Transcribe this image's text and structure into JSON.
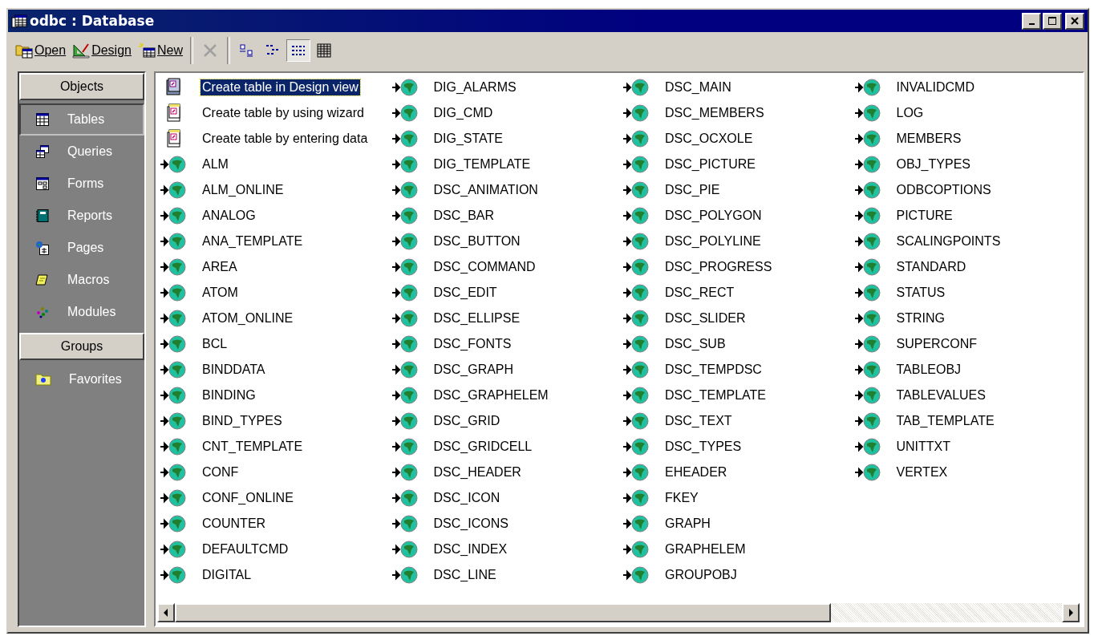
{
  "window": {
    "title": "odbc : Database"
  },
  "toolbar": {
    "buttons": [
      {
        "label": "Open",
        "kind": "open"
      },
      {
        "label": "Design",
        "kind": "design"
      },
      {
        "label": "New",
        "kind": "new"
      }
    ],
    "delete_disabled": true,
    "views": [
      {
        "kind": "large",
        "selected": false
      },
      {
        "kind": "small",
        "selected": false
      },
      {
        "kind": "list",
        "selected": true
      },
      {
        "kind": "details",
        "selected": false
      }
    ]
  },
  "sidebar": {
    "objects_header": "Objects",
    "items": [
      {
        "label": "Tables",
        "kind": "tables",
        "selected": true
      },
      {
        "label": "Queries",
        "kind": "queries",
        "selected": false
      },
      {
        "label": "Forms",
        "kind": "forms",
        "selected": false
      },
      {
        "label": "Reports",
        "kind": "reports",
        "selected": false
      },
      {
        "label": "Pages",
        "kind": "pages",
        "selected": false
      },
      {
        "label": "Macros",
        "kind": "macros",
        "selected": false
      },
      {
        "label": "Modules",
        "kind": "modules",
        "selected": false
      }
    ],
    "groups_header": "Groups",
    "groups": [
      {
        "label": "Favorites",
        "kind": "favorites",
        "selected": false
      }
    ]
  },
  "list": {
    "items": [
      {
        "label": "Create table in Design view",
        "kind": "design",
        "selected": true
      },
      {
        "label": "Create table by using wizard",
        "kind": "wizard",
        "selected": false
      },
      {
        "label": "Create table by entering data",
        "kind": "wizard",
        "selected": false
      },
      {
        "label": "ALM",
        "kind": "table",
        "selected": false
      },
      {
        "label": "ALM_ONLINE",
        "kind": "table",
        "selected": false
      },
      {
        "label": "ANALOG",
        "kind": "table",
        "selected": false
      },
      {
        "label": "ANA_TEMPLATE",
        "kind": "table",
        "selected": false
      },
      {
        "label": "AREA",
        "kind": "table",
        "selected": false
      },
      {
        "label": "ATOM",
        "kind": "table",
        "selected": false
      },
      {
        "label": "ATOM_ONLINE",
        "kind": "table",
        "selected": false
      },
      {
        "label": "BCL",
        "kind": "table",
        "selected": false
      },
      {
        "label": "BINDDATA",
        "kind": "table",
        "selected": false
      },
      {
        "label": "BINDING",
        "kind": "table",
        "selected": false
      },
      {
        "label": "BIND_TYPES",
        "kind": "table",
        "selected": false
      },
      {
        "label": "CNT_TEMPLATE",
        "kind": "table",
        "selected": false
      },
      {
        "label": "CONF",
        "kind": "table",
        "selected": false
      },
      {
        "label": "CONF_ONLINE",
        "kind": "table",
        "selected": false
      },
      {
        "label": "COUNTER",
        "kind": "table",
        "selected": false
      },
      {
        "label": "DEFAULTCMD",
        "kind": "table",
        "selected": false
      },
      {
        "label": "DIGITAL",
        "kind": "table",
        "selected": false
      },
      {
        "label": "DIG_ALARMS",
        "kind": "table",
        "selected": false
      },
      {
        "label": "DIG_CMD",
        "kind": "table",
        "selected": false
      },
      {
        "label": "DIG_STATE",
        "kind": "table",
        "selected": false
      },
      {
        "label": "DIG_TEMPLATE",
        "kind": "table",
        "selected": false
      },
      {
        "label": "DSC_ANIMATION",
        "kind": "table",
        "selected": false
      },
      {
        "label": "DSC_BAR",
        "kind": "table",
        "selected": false
      },
      {
        "label": "DSC_BUTTON",
        "kind": "table",
        "selected": false
      },
      {
        "label": "DSC_COMMAND",
        "kind": "table",
        "selected": false
      },
      {
        "label": "DSC_EDIT",
        "kind": "table",
        "selected": false
      },
      {
        "label": "DSC_ELLIPSE",
        "kind": "table",
        "selected": false
      },
      {
        "label": "DSC_FONTS",
        "kind": "table",
        "selected": false
      },
      {
        "label": "DSC_GRAPH",
        "kind": "table",
        "selected": false
      },
      {
        "label": "DSC_GRAPHELEM",
        "kind": "table",
        "selected": false
      },
      {
        "label": "DSC_GRID",
        "kind": "table",
        "selected": false
      },
      {
        "label": "DSC_GRIDCELL",
        "kind": "table",
        "selected": false
      },
      {
        "label": "DSC_HEADER",
        "kind": "table",
        "selected": false
      },
      {
        "label": "DSC_ICON",
        "kind": "table",
        "selected": false
      },
      {
        "label": "DSC_ICONS",
        "kind": "table",
        "selected": false
      },
      {
        "label": "DSC_INDEX",
        "kind": "table",
        "selected": false
      },
      {
        "label": "DSC_LINE",
        "kind": "table",
        "selected": false
      },
      {
        "label": "DSC_MAIN",
        "kind": "table",
        "selected": false
      },
      {
        "label": "DSC_MEMBERS",
        "kind": "table",
        "selected": false
      },
      {
        "label": "DSC_OCXOLE",
        "kind": "table",
        "selected": false
      },
      {
        "label": "DSC_PICTURE",
        "kind": "table",
        "selected": false
      },
      {
        "label": "DSC_PIE",
        "kind": "table",
        "selected": false
      },
      {
        "label": "DSC_POLYGON",
        "kind": "table",
        "selected": false
      },
      {
        "label": "DSC_POLYLINE",
        "kind": "table",
        "selected": false
      },
      {
        "label": "DSC_PROGRESS",
        "kind": "table",
        "selected": false
      },
      {
        "label": "DSC_RECT",
        "kind": "table",
        "selected": false
      },
      {
        "label": "DSC_SLIDER",
        "kind": "table",
        "selected": false
      },
      {
        "label": "DSC_SUB",
        "kind": "table",
        "selected": false
      },
      {
        "label": "DSC_TEMPDSC",
        "kind": "table",
        "selected": false
      },
      {
        "label": "DSC_TEMPLATE",
        "kind": "table",
        "selected": false
      },
      {
        "label": "DSC_TEXT",
        "kind": "table",
        "selected": false
      },
      {
        "label": "DSC_TYPES",
        "kind": "table",
        "selected": false
      },
      {
        "label": "EHEADER",
        "kind": "table",
        "selected": false
      },
      {
        "label": "FKEY",
        "kind": "table",
        "selected": false
      },
      {
        "label": "GRAPH",
        "kind": "table",
        "selected": false
      },
      {
        "label": "GRAPHELEM",
        "kind": "table",
        "selected": false
      },
      {
        "label": "GROUPOBJ",
        "kind": "table",
        "selected": false
      },
      {
        "label": "INVALIDCMD",
        "kind": "table",
        "selected": false
      },
      {
        "label": "LOG",
        "kind": "table",
        "selected": false
      },
      {
        "label": "MEMBERS",
        "kind": "table",
        "selected": false
      },
      {
        "label": "OBJ_TYPES",
        "kind": "table",
        "selected": false
      },
      {
        "label": "ODBCOPTIONS",
        "kind": "table",
        "selected": false
      },
      {
        "label": "PICTURE",
        "kind": "table",
        "selected": false
      },
      {
        "label": "SCALINGPOINTS",
        "kind": "table",
        "selected": false
      },
      {
        "label": "STANDARD",
        "kind": "table",
        "selected": false
      },
      {
        "label": "STATUS",
        "kind": "table",
        "selected": false
      },
      {
        "label": "STRING",
        "kind": "table",
        "selected": false
      },
      {
        "label": "SUPERCONF",
        "kind": "table",
        "selected": false
      },
      {
        "label": "TABLEOBJ",
        "kind": "table",
        "selected": false
      },
      {
        "label": "TABLEVALUES",
        "kind": "table",
        "selected": false
      },
      {
        "label": "TAB_TEMPLATE",
        "kind": "table",
        "selected": false
      },
      {
        "label": "UNITTXT",
        "kind": "table",
        "selected": false
      },
      {
        "label": "VERTEX",
        "kind": "table",
        "selected": false
      }
    ]
  }
}
